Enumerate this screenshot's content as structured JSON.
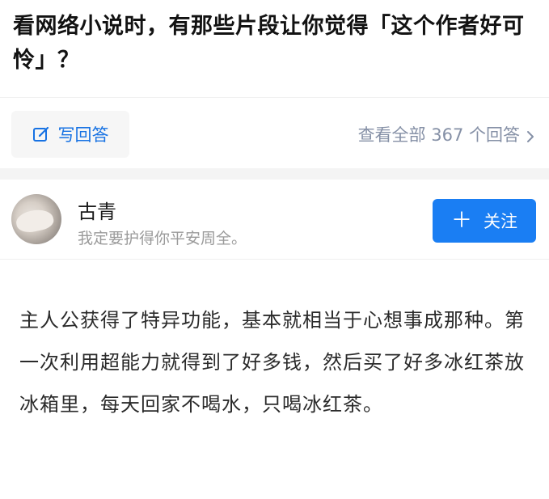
{
  "question": {
    "title": "看网络小说时，有那些片段让你觉得「这个作者好可怜」？"
  },
  "actions": {
    "write_answer_label": "写回答",
    "view_all_label": "查看全部 367 个回答"
  },
  "author": {
    "name": "古青",
    "bio": "我定要护得你平安周全。",
    "follow_label": "关注"
  },
  "answer": {
    "text": "主人公获得了特异功能，基本就相当于心想事成那种。第一次利用超能力就得到了好多钱，然后买了好多冰红茶放冰箱里，每天回家不喝水，只喝冰红茶。"
  },
  "colors": {
    "accent": "#1a7ef3",
    "link_blue": "#1772e3",
    "muted": "#8590a6"
  }
}
